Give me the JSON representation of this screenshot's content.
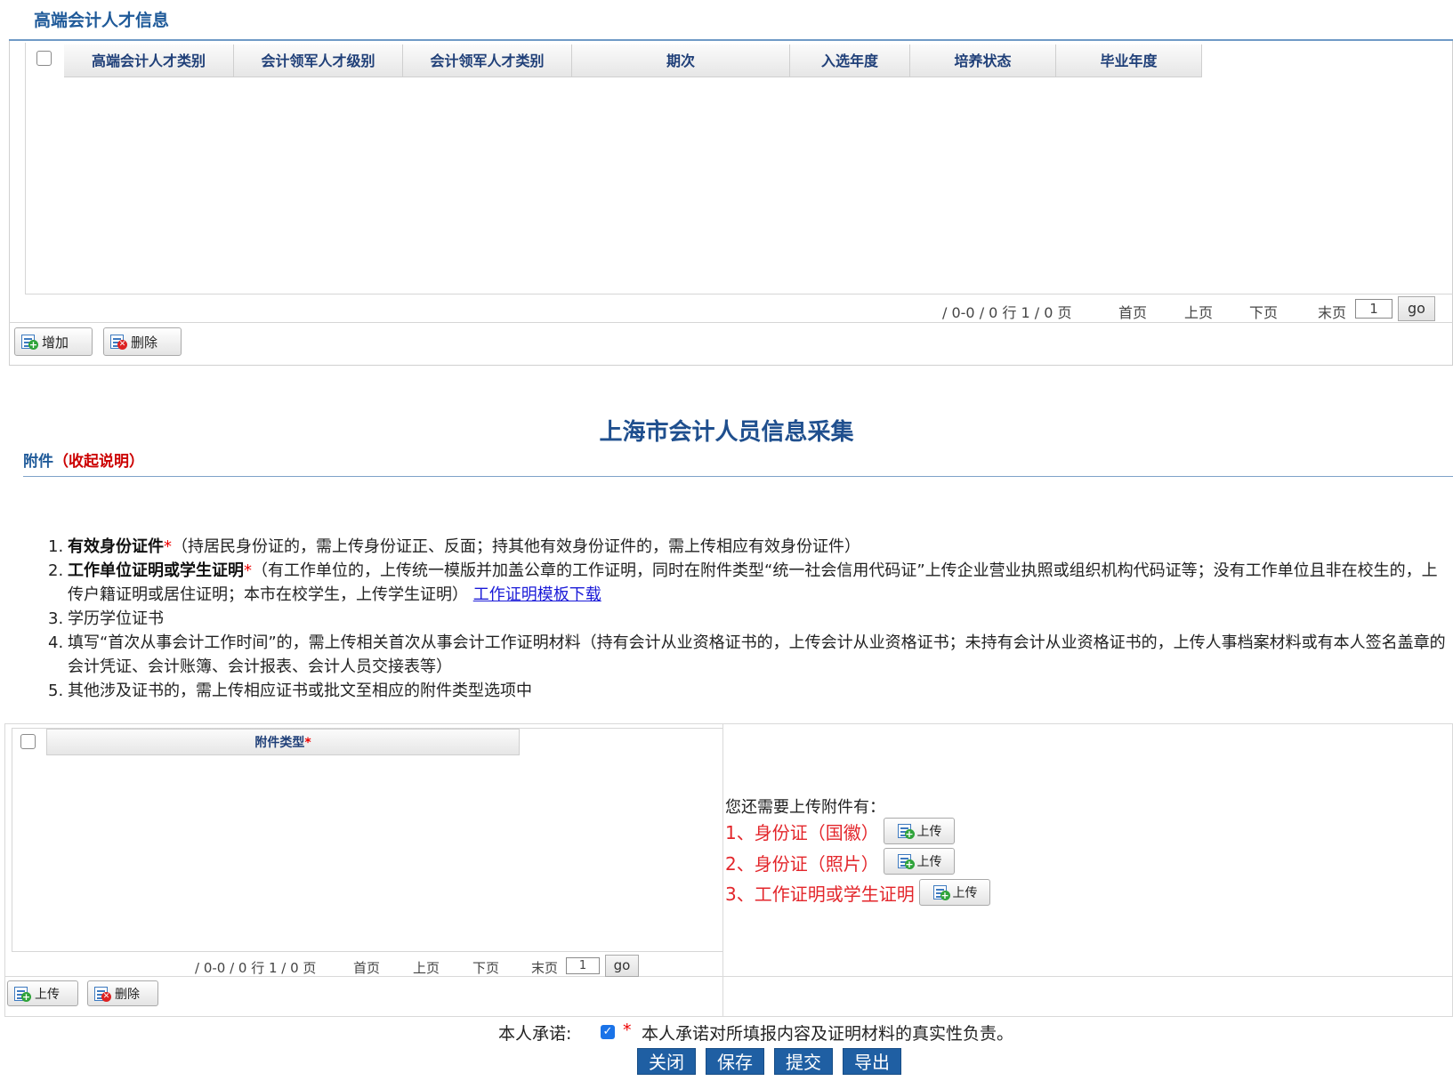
{
  "talent_section": {
    "title": "高端会计人才信息",
    "columns": [
      "高端会计人才类别",
      "会计领军人才级别",
      "会计领军人才类别",
      "期次",
      "入选年度",
      "培养状态",
      "毕业年度"
    ],
    "rows": []
  },
  "pager_top": {
    "summary": "/ 0-0 / 0 行 1 / 0 页",
    "first": "首页",
    "prev": "上页",
    "next": "下页",
    "last": "末页",
    "page_value": "1",
    "go": "go"
  },
  "toolbar_top": {
    "add_label": "增加",
    "delete_label": "删除"
  },
  "main_title": "上海市会计人员信息采集",
  "attachments": {
    "head_label": "附件",
    "toggle_label": "（收起说明）",
    "notes": [
      {
        "num": "1.",
        "bold": "有效身份证件",
        "required": "*",
        "text": "（持居民身份证的，需上传身份证正、反面；持其他有效身份证件的，需上传相应有效身份证件）"
      },
      {
        "num": "2.",
        "bold": "工作单位证明或学生证明",
        "required": "*",
        "text": "（有工作单位的，上传统一模版并加盖公章的工作证明，同时在附件类型“统一社会信用代码证”上传企业营业执照或组织机构代码证等；没有工作单位且非在校生的，上传户籍证明或居住证明；本市在校学生，上传学生证明）",
        "link": "工作证明模板下载"
      },
      {
        "num": "3.",
        "text": "学历学位证书"
      },
      {
        "num": "4.",
        "text": "填写“首次从事会计工作时间”的，需上传相关首次从事会计工作证明材料（持有会计从业资格证书的，上传会计从业资格证书；未持有会计从业资格证书的，上传人事档案材料或有本人签名盖章的会计凭证、会计账簿、会计报表、会计人员交接表等）"
      },
      {
        "num": "5.",
        "text": "其他涉及证书的，需上传相应证书或批文至相应的附件类型选项中"
      }
    ],
    "grid_header": "附件类型",
    "grid_required": "*",
    "pager": {
      "summary": "/ 0-0 / 0 行 1 / 0 页",
      "first": "首页",
      "prev": "上页",
      "next": "下页",
      "last": "末页",
      "page_value": "1",
      "go": "go"
    },
    "toolbar": {
      "upload_label": "上传",
      "delete_label": "删除"
    },
    "needed_title": "您还需要上传附件有：",
    "needed_items": [
      "1、身份证（国徽）",
      "2、身份证（照片）",
      "3、工作证明或学生证明"
    ],
    "upload_label": "上传"
  },
  "promise": {
    "label": "本人承诺:",
    "checked": true,
    "required": "*",
    "text": "本人承诺对所填报内容及证明材料的真实性负责。"
  },
  "actions": {
    "close": "关闭",
    "save": "保存",
    "submit": "提交",
    "export": "导出"
  },
  "colors": {
    "accent": "#1f5fa3",
    "title_blue": "#1f4f8e",
    "required_red": "#e00",
    "header_text": "#1f3f78"
  }
}
